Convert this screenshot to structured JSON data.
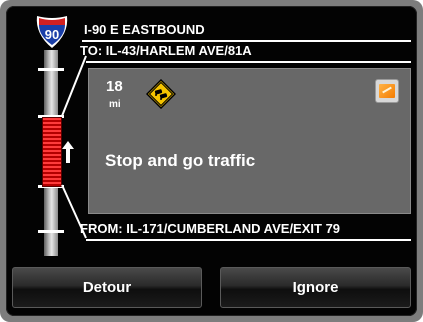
{
  "route": {
    "shield_number": "90",
    "road_title": "I-90 E EASTBOUND",
    "to_label": "TO: IL-43/HARLEM AVE/81A",
    "from_label": "FROM: IL-171/CUMBERLAND AVE/EXIT 79"
  },
  "event": {
    "distance_value": "18",
    "distance_unit": "mi",
    "sign_icon": "traffic-congestion-sign-icon",
    "map_button_icon": "map-icon",
    "description": "Stop and go traffic"
  },
  "actions": {
    "detour_label": "Detour",
    "ignore_label": "Ignore"
  },
  "colors": {
    "shield_blue": "#1a3fa8",
    "shield_red": "#d22020",
    "sign_yellow": "#f5c400",
    "congestion_red": "#ff3b3b",
    "info_box_gray": "#686868"
  }
}
